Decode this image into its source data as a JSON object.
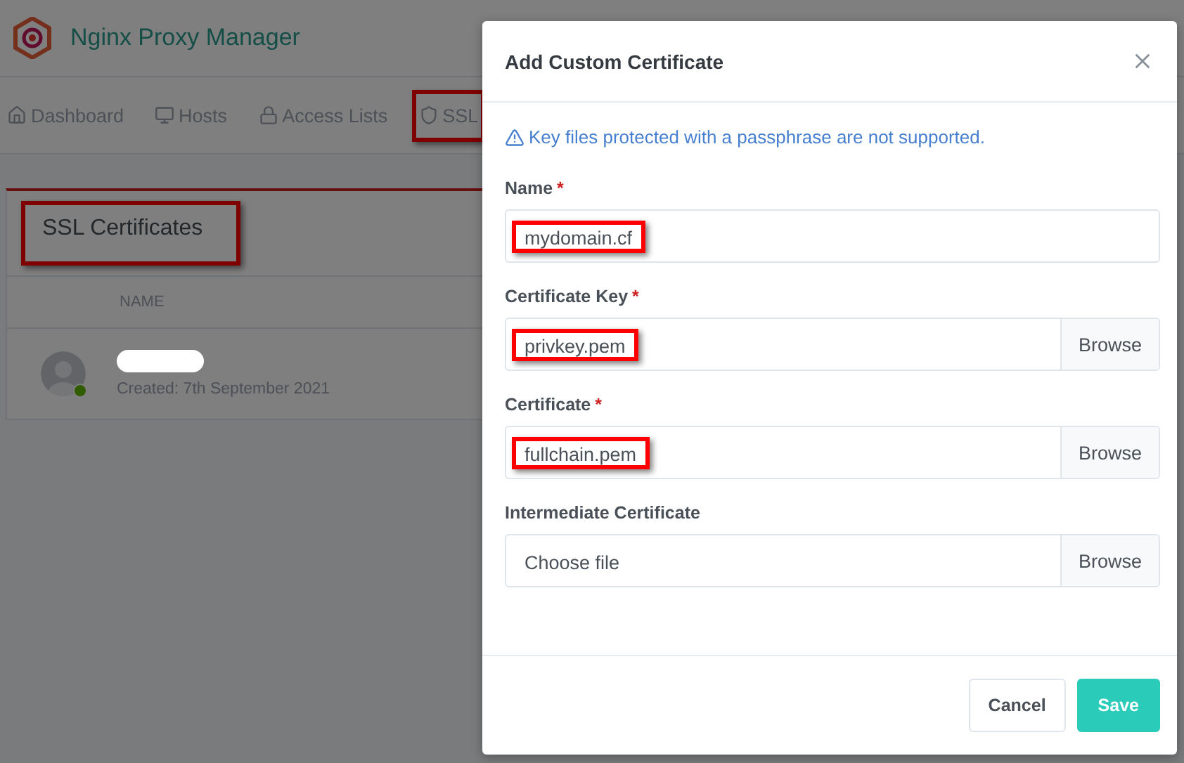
{
  "app": {
    "title": "Nginx Proxy Manager"
  },
  "nav": [
    {
      "label": "Dashboard",
      "highlighted": false
    },
    {
      "label": "Hosts",
      "highlighted": false
    },
    {
      "label": "Access Lists",
      "highlighted": false
    },
    {
      "label": "SSL",
      "highlighted": true
    }
  ],
  "card": {
    "title": "SSL Certificates",
    "title_highlighted": true,
    "columns": [
      "NAME"
    ],
    "rows": [
      {
        "created": "Created: 7th September 2021",
        "online": true
      }
    ]
  },
  "dialog": {
    "title": "Add Custom Certificate",
    "alert": "Key files protected with a passphrase are not supported.",
    "fields": [
      {
        "kind": "text",
        "label": "Name",
        "required_mark": "*",
        "value": "mydomain.cf",
        "highlighted": true
      },
      {
        "kind": "file",
        "label": "Certificate Key",
        "required_mark": "*",
        "value": "privkey.pem",
        "button": "Browse",
        "highlighted": true
      },
      {
        "kind": "file",
        "label": "Certificate",
        "required_mark": "*",
        "value": "fullchain.pem",
        "button": "Browse",
        "highlighted": true
      },
      {
        "kind": "file",
        "label": "Intermediate Certificate",
        "placeholder": "Choose file",
        "button": "Browse",
        "highlighted": false
      }
    ],
    "buttons": [
      {
        "label": "Cancel",
        "kind": "secondary"
      },
      {
        "label": "Save",
        "kind": "primary"
      }
    ]
  }
}
